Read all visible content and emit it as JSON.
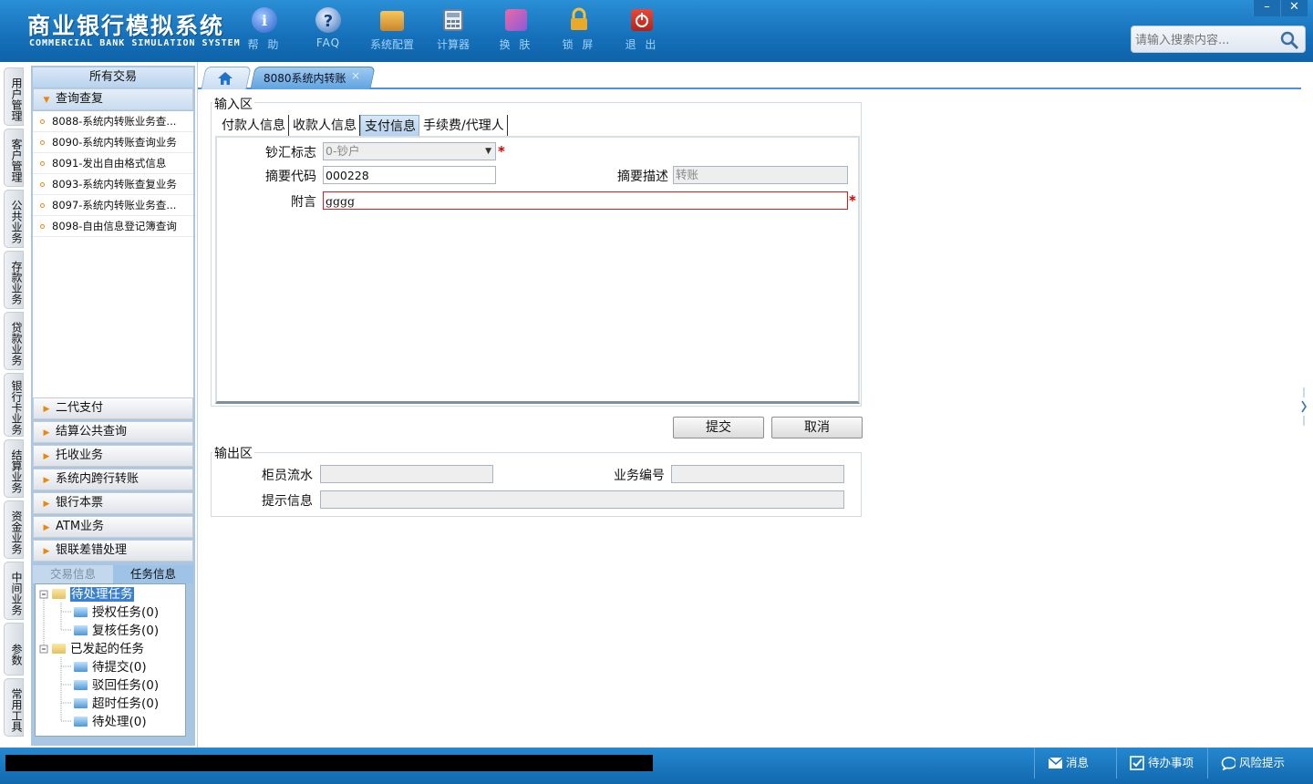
{
  "app": {
    "title": "商业银行模拟系统",
    "subtitle": "COMMERCIAL BANK SIMULATION SYSTEM"
  },
  "toolbar": [
    {
      "label": "帮 助",
      "icon": "help-icon"
    },
    {
      "label": "FAQ",
      "icon": "faq-icon"
    },
    {
      "label": "系统配置",
      "icon": "toolbox-icon"
    },
    {
      "label": "计算器",
      "icon": "calculator-icon"
    },
    {
      "label": "换 肤",
      "icon": "shirt-icon"
    },
    {
      "label": "锁 屏",
      "icon": "lock-icon"
    },
    {
      "label": "退 出",
      "icon": "power-icon"
    }
  ],
  "window_controls": {
    "minimize": "–",
    "close": "✕"
  },
  "search": {
    "placeholder": "请输入搜索内容..."
  },
  "vnav": [
    "用户管理",
    "客户管理",
    "公共业务",
    "存款业务",
    "贷款业务",
    "银行卡业务",
    "结算业务",
    "资金业务",
    "中间业务",
    "参数",
    "常用工具"
  ],
  "leftpanel": {
    "header": "所有交易",
    "open_group": "查询查复",
    "transactions": [
      "8088-系统内转账业务查...",
      "8090-系统内转账查询业务",
      "8091-发出自由格式信息",
      "8093-系统内转账查复业务",
      "8097-系统内转账业务查...",
      "8098-自由信息登记簿查询"
    ],
    "groups": [
      "二代支付",
      "结算公共查询",
      "托收业务",
      "系统内跨行转账",
      "银行本票",
      "ATM业务",
      "银联差错处理"
    ],
    "info_tabs": [
      "交易信息",
      "任务信息"
    ],
    "tree": {
      "pending": "待处理任务",
      "auth": "授权任务(0)",
      "review": "复核任务(0)",
      "initiated": "已发起的任务",
      "to_submit": "待提交(0)",
      "rejected": "驳回任务(0)",
      "timeout": "超时任务(0)",
      "todo": "待处理(0)"
    }
  },
  "tabs": {
    "active": "8080系统内转账",
    "close": "×"
  },
  "input_area": {
    "legend": "输入区",
    "subtabs": [
      "付款人信息",
      "收款人信息",
      "支付信息",
      "手续费/代理人"
    ],
    "active_subtab": 2,
    "fields": {
      "cash_flag_label": "钞汇标志",
      "cash_flag_value": "0-钞户",
      "summary_code_label": "摘要代码",
      "summary_code_value": "000228",
      "summary_desc_label": "摘要描述",
      "summary_desc_value": "转账",
      "remark_label": "附言",
      "remark_value": "gggg"
    },
    "required_mark": "*"
  },
  "buttons": {
    "submit": "提交",
    "cancel": "取消"
  },
  "output_area": {
    "legend": "输出区",
    "teller_serial_label": "柜员流水",
    "business_no_label": "业务编号",
    "message_label": "提示信息"
  },
  "statusbar": {
    "messages": "消息",
    "todo": "待办事项",
    "risk": "风险提示"
  },
  "colors": {
    "header_blue": "#1570b9",
    "accent": "#4a94d6",
    "required": "#d40000",
    "remark_border": "#d32020"
  }
}
